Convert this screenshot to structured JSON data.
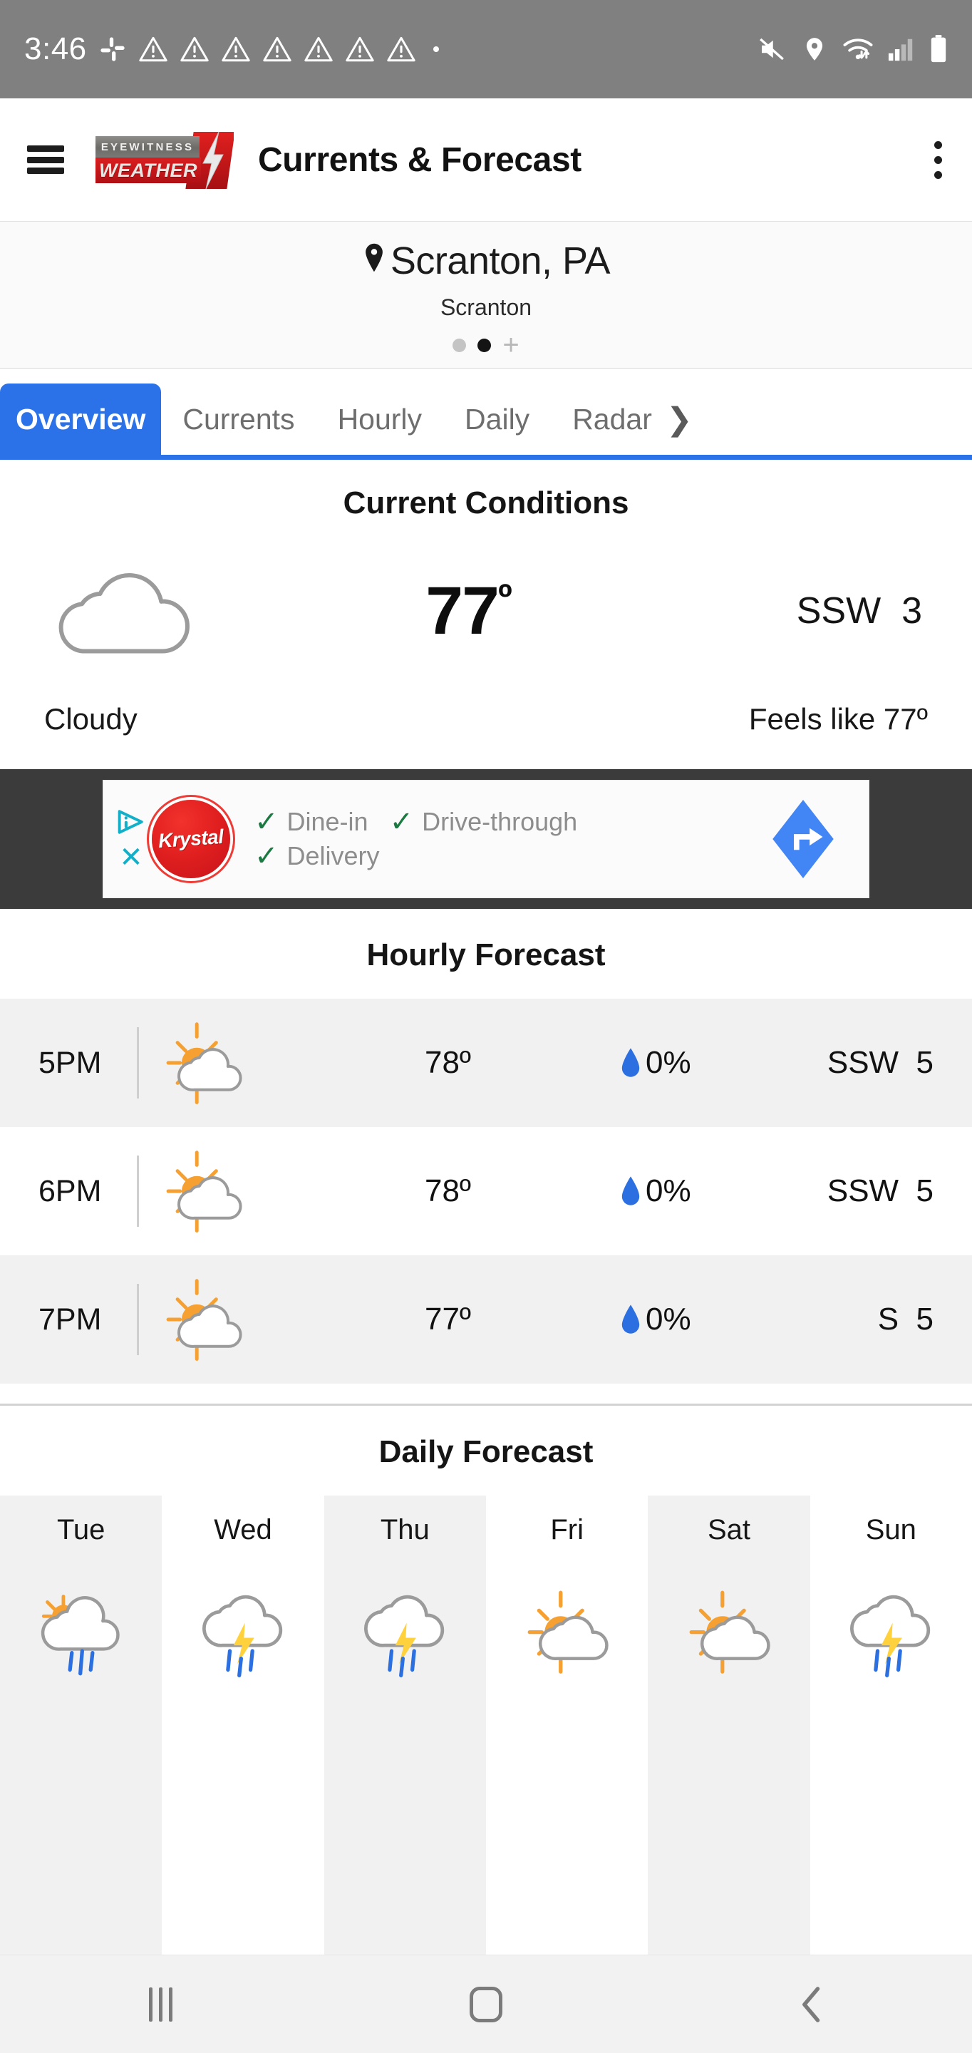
{
  "status_bar": {
    "time": "3:46",
    "left_icons": [
      "slack-icon",
      "warning-icon",
      "warning-icon",
      "warning-icon",
      "warning-icon",
      "warning-icon",
      "warning-icon",
      "warning-icon",
      "dot-icon"
    ],
    "right_icons": [
      "mute-icon",
      "location-pin-icon",
      "wifi-icon",
      "signal-bars-icon",
      "battery-icon"
    ],
    "background": "#808080"
  },
  "app_bar": {
    "menu_icon": "hamburger-menu-icon",
    "logo_line1": "EYEWITNESS",
    "logo_line2": "WEATHER",
    "title": "Currents & Forecast",
    "overflow_icon": "kebab-menu-icon"
  },
  "location": {
    "pin_icon": "location-pin-icon",
    "city": "Scranton, PA",
    "subtitle": "Scranton",
    "dots": [
      {
        "active": false
      },
      {
        "active": true
      }
    ],
    "add_label": "+"
  },
  "tabs": {
    "items": [
      {
        "label": "Overview",
        "active": true
      },
      {
        "label": "Currents",
        "active": false
      },
      {
        "label": "Hourly",
        "active": false
      },
      {
        "label": "Daily",
        "active": false
      },
      {
        "label": "Radar",
        "active": false
      }
    ],
    "more_icon": "chevron-right-icon",
    "active_color": "#2b72e8"
  },
  "current_conditions": {
    "title": "Current Conditions",
    "icon": "cloudy-icon",
    "temperature": "77",
    "degree": "º",
    "wind": "SSW  3",
    "condition": "Cloudy",
    "feels_like": "Feels like 77º"
  },
  "advertisement": {
    "info_icon": "ad-info-icon",
    "close_icon": "close-icon",
    "brand": "Krystal",
    "features": [
      "Dine-in",
      "Drive-through",
      "Delivery"
    ],
    "check_icon": "check-icon",
    "cta_icon": "directions-icon",
    "cta_color": "#4285f4",
    "brand_color": "#e01f1f",
    "check_color": "#1a7a41"
  },
  "hourly_forecast": {
    "title": "Hourly Forecast",
    "rows": [
      {
        "time": "5PM",
        "icon": "partly-cloudy-icon",
        "temp": "78º",
        "pop": "0%",
        "wind": "SSW  5"
      },
      {
        "time": "6PM",
        "icon": "partly-cloudy-icon",
        "temp": "78º",
        "pop": "0%",
        "wind": "SSW  5"
      },
      {
        "time": "7PM",
        "icon": "partly-cloudy-icon",
        "temp": "77º",
        "pop": "0%",
        "wind": "S  5"
      }
    ],
    "drop_icon": "water-drop-icon",
    "drop_color": "#2b6fe0"
  },
  "daily_forecast": {
    "title": "Daily Forecast",
    "days": [
      {
        "label": "Tue",
        "icon": "sun-cloud-rain-icon"
      },
      {
        "label": "Wed",
        "icon": "thunderstorm-icon"
      },
      {
        "label": "Thu",
        "icon": "thunderstorm-icon"
      },
      {
        "label": "Fri",
        "icon": "partly-cloudy-icon"
      },
      {
        "label": "Sat",
        "icon": "partly-cloudy-icon"
      },
      {
        "label": "Sun",
        "icon": "thunderstorm-icon"
      }
    ]
  },
  "nav_bar": {
    "recents_icon": "recents-icon",
    "home_icon": "home-icon",
    "back_icon": "back-icon"
  }
}
